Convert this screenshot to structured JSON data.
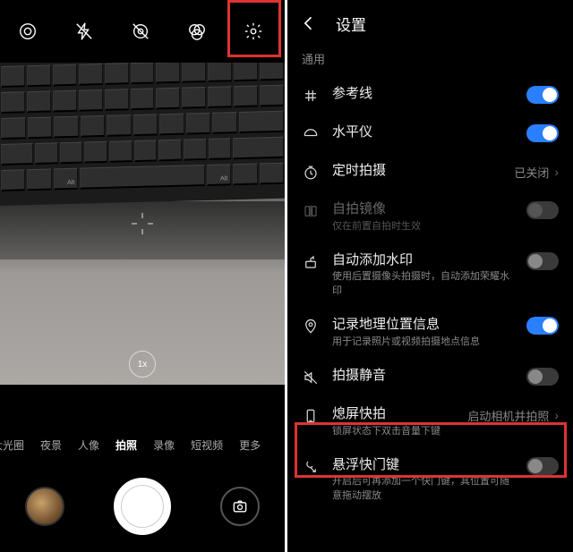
{
  "camera": {
    "zoom_label": "1x",
    "modes": [
      "大光圈",
      "夜景",
      "人像",
      "拍照",
      "录像",
      "短视频",
      "更多"
    ],
    "active_mode_index": 3
  },
  "settings": {
    "header_title": "设置",
    "section": "通用",
    "rows": [
      {
        "id": "grid",
        "label": "参考线",
        "sub": "",
        "type": "toggle",
        "on": true,
        "enabled": true
      },
      {
        "id": "level",
        "label": "水平仪",
        "sub": "",
        "type": "toggle",
        "on": true,
        "enabled": true
      },
      {
        "id": "timer",
        "label": "定时拍摄",
        "sub": "",
        "type": "link",
        "value": "已关闭",
        "enabled": true
      },
      {
        "id": "mirror",
        "label": "自拍镜像",
        "sub": "仅在前置自拍时生效",
        "type": "toggle",
        "on": false,
        "enabled": false
      },
      {
        "id": "watermark",
        "label": "自动添加水印",
        "sub": "使用后置摄像头拍摄时，自动添加荣耀水印",
        "type": "toggle",
        "on": false,
        "enabled": true
      },
      {
        "id": "location",
        "label": "记录地理位置信息",
        "sub": "用于记录照片或视频拍摄地点信息",
        "type": "toggle",
        "on": true,
        "enabled": true
      },
      {
        "id": "mute",
        "label": "拍摄静音",
        "sub": "",
        "type": "toggle",
        "on": false,
        "enabled": true
      },
      {
        "id": "quickshot",
        "label": "熄屏快拍",
        "sub": "锁屏状态下双击音量下键",
        "type": "link",
        "value": "启动相机并拍照",
        "enabled": true
      },
      {
        "id": "floatshutter",
        "label": "悬浮快门键",
        "sub": "开启后可再添加一个快门键，其位置可随意拖动摆放",
        "type": "toggle",
        "on": false,
        "enabled": true
      }
    ]
  }
}
